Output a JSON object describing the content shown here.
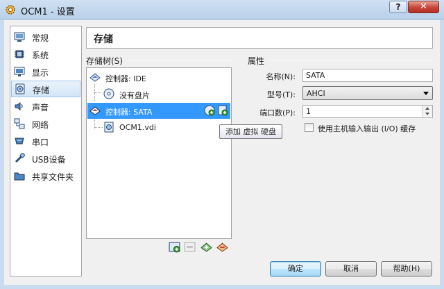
{
  "window": {
    "title": "OCM1 - 设置",
    "help_label": "?",
    "close_label": "✕"
  },
  "sidebar": {
    "items": [
      {
        "label": "常规",
        "icon": "general-icon"
      },
      {
        "label": "系统",
        "icon": "system-icon"
      },
      {
        "label": "显示",
        "icon": "display-icon"
      },
      {
        "label": "存储",
        "icon": "storage-icon",
        "selected": true
      },
      {
        "label": "声音",
        "icon": "audio-icon"
      },
      {
        "label": "网络",
        "icon": "network-icon"
      },
      {
        "label": "串口",
        "icon": "serial-port-icon"
      },
      {
        "label": "USB设备",
        "icon": "usb-icon"
      },
      {
        "label": "共享文件夹",
        "icon": "shared-folder-icon"
      }
    ]
  },
  "page_title": "存储",
  "storage_tree": {
    "label": "存储树(S)",
    "controller_ide": "控制器: IDE",
    "empty_disk": "没有盘片",
    "controller_sata": "控制器: SATA",
    "disk_file": "OCM1.vdi",
    "tooltip": "添加 虚拟 硬盘"
  },
  "attributes": {
    "header": "属性",
    "name_label": "名称(N):",
    "name_value": "SATA",
    "type_label": "型号(T):",
    "type_value": "AHCI",
    "port_label": "端口数(P):",
    "port_value": "1",
    "cache_label": "使用主机输入输出 (I/O) 缓存",
    "cache_checked": false
  },
  "buttons": {
    "ok": "确定",
    "cancel": "取消",
    "help": "帮助(H)"
  },
  "colors": {
    "selection": "#3399ff",
    "titlebar": "#cfe0f2",
    "close": "#c7443a"
  }
}
